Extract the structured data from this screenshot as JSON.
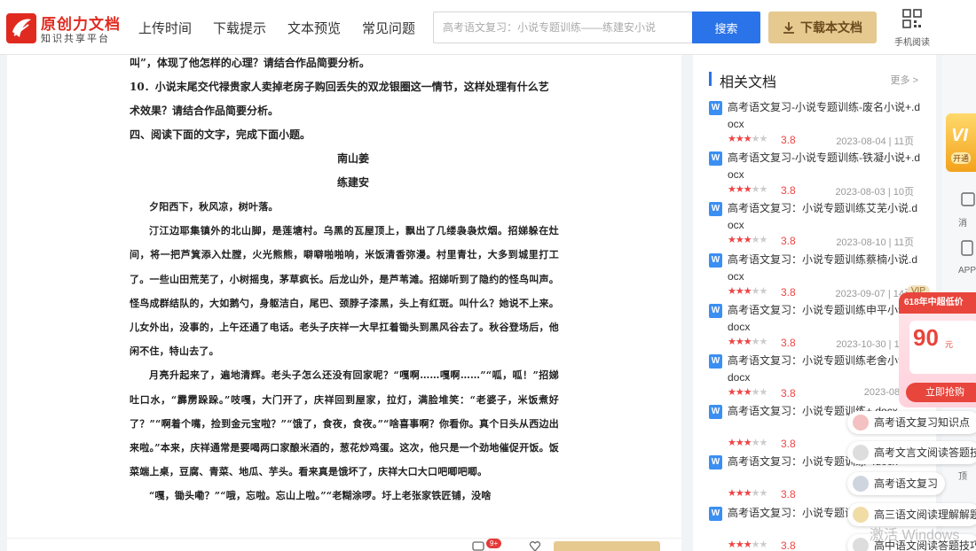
{
  "header": {
    "logo_title": "原创力文档",
    "logo_subtitle": "知识共享平台",
    "nav": [
      "上传时间",
      "下载提示",
      "文本预览",
      "常见问题"
    ],
    "search_placeholder": "高考语文复习：小说专题训练——练建安小说",
    "search_button": "搜索",
    "download_button": "下载本文档",
    "mobile_label": "手机阅读"
  },
  "document": {
    "lines": [
      "叫”，体现了他怎样的心理？请结合作品简要分析。",
      "10．小说末尾交代禄贵家人卖掉老房子购回丢失的双龙银圈这一情节，这样处理有什么艺",
      "术效果？请结合作品简要分析。",
      "四、阅读下面的文字，完成下面小题。"
    ],
    "story_title": "南山姜",
    "story_author": "练建安",
    "paragraphs": [
      "夕阳西下，秋风凉，树叶落。",
      "汀江边耶集镇外的北山脚，是莲塘村。乌黑的瓦屋顶上，飘出了几缕袅袅炊烟。招娣躲在灶间，将一把芦箕添入灶膛，火光熊熊，噼噼啪啪响，米饭清香弥漫。村里青壮，大多到城里打工了。一些山田荒芜了，小树摇曳，茅草疯长。后龙山外，是芦苇滩。招娣听到了隐约的怪鸟叫声。怪鸟成群结队的，大如鹅勺，身躯洁白，尾巴、颈脖子漆黑，头上有红斑。叫什么？她说不上来。儿女外出，没事的，上午还通了电话。老头子庆祥一大早扛着锄头到黑风谷去了。秋谷登场后，他闲不住，特山去了。",
      "月亮升起来了，遍地清辉。老头子怎么还没有回家呢？“嘎啊……嘎啊……”“呱，呱！”招娣吐口水，“霹雳跺跺。”吱嘎，大门开了，庆祥回到屋家，拉灯，满脸堆笑：“老婆子，米饭煮好了？”“啊着个嘴，捡到金元宝啦？”“饿了，食夜，食夜。”“啥喜事啊？你看你。真个日头从西边出来啦。”本来，庆祥通常是要喝两口家酿米酒的，葱花炒鸡蛋。这次，他只是一个劲地催促开饭。饭菜端上桌，豆腐、青菜、地瓜、芋头。看来真是饿坏了，庆祥大口大口吧唧吧唧。",
      "“嘎，锄头嘞？”“哦，忘啦。忘山上啦。”“老糊涂啰。圩上老张家铁匠铺，没啥"
    ]
  },
  "sidebar": {
    "title": "相关文档",
    "more": "更多 >",
    "items": [
      {
        "title": "高考语文复习-小说专题训练-废名小说+.docx",
        "rating": 3.8,
        "date": "2023-08-04",
        "pages": "11页",
        "vip": ""
      },
      {
        "title": "高考语文复习-小说专题训练-铁凝小说+.docx",
        "rating": 3.8,
        "date": "2023-08-03",
        "pages": "10页",
        "vip": ""
      },
      {
        "title": "高考语文复习：小说专题训练艾芜小说.docx",
        "rating": 3.8,
        "date": "2023-08-10",
        "pages": "11页",
        "vip": ""
      },
      {
        "title": "高考语文复习：小说专题训练蔡楠小说.docx",
        "rating": 3.8,
        "date": "2023-09-07",
        "pages": "14页",
        "vip": "VIP"
      },
      {
        "title": "高考语文复习：小说专题训练申平小说+.docx",
        "rating": 3.8,
        "date": "2023-10-30",
        "pages": "11页",
        "vip": ""
      },
      {
        "title": "高考语文复习：小说专题训练老舍小说+.docx",
        "rating": 3.8,
        "date": "2023-08-01",
        "pages": "",
        "vip": ""
      },
      {
        "title": "高考语文复习：小说专题训练+.docx",
        "rating": 3.8,
        "date": "",
        "pages": "",
        "vip": ""
      },
      {
        "title": "高考语文复习：小说专题训练+.docx",
        "rating": 3.8,
        "date": "",
        "pages": "",
        "vip": ""
      },
      {
        "title": "高考语文复习：小说专题训练小说.docx",
        "rating": 3.8,
        "date": "",
        "pages": "",
        "vip": ""
      }
    ]
  },
  "right_strip": {
    "vip_text": "VI",
    "vip_sub": "开通",
    "msg_label": "消",
    "app_label": "APP",
    "last_label": "顶"
  },
  "promo": {
    "top": "618年中超低价",
    "amount": "90",
    "unit": "元",
    "button": "立即抢购"
  },
  "chips": [
    "高考语文复习知识点",
    "高考文言文阅读答题技巧",
    "高考语文复习",
    "高三语文阅读理解解题",
    "高中语文阅读答题技巧"
  ],
  "bottom": {
    "badge": "9+"
  },
  "watermark": "激活 Windows",
  "colors": {
    "brand_red": "#e02a20",
    "search_blue": "#2a73e8",
    "download_gold": "#e6c98f",
    "star_red": "#e44444"
  }
}
